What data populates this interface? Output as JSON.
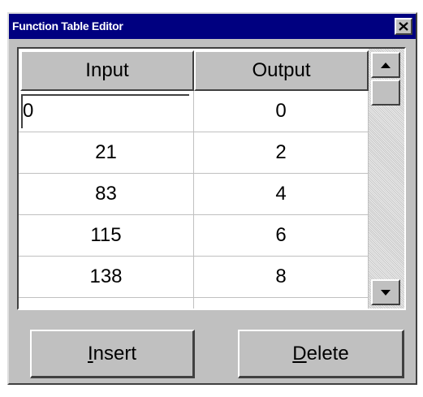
{
  "window": {
    "title": "Function Table Editor"
  },
  "table": {
    "columns": [
      "Input",
      "Output"
    ],
    "rows": [
      {
        "input": "0",
        "output": "0"
      },
      {
        "input": "21",
        "output": "2"
      },
      {
        "input": "83",
        "output": "4"
      },
      {
        "input": "115",
        "output": "6"
      },
      {
        "input": "138",
        "output": "8"
      }
    ]
  },
  "buttons": {
    "insert": {
      "mnemonic": "I",
      "rest": "nsert"
    },
    "delete": {
      "mnemonic": "D",
      "rest": "elete"
    }
  },
  "icons": {
    "close": "close-icon",
    "scroll_up": "arrow-up-icon",
    "scroll_down": "arrow-down-icon"
  }
}
